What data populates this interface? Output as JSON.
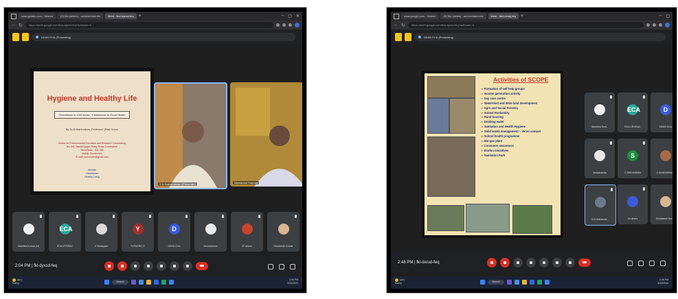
{
  "left": {
    "tabs": [
      "www.gstatic.com - Search",
      "(9) Bio (slides) - archivetuberrofs",
      "Meet - fkul-dyexd-feq"
    ],
    "url": "https://meet.google.com/fkul-dyexd-feq?authuser=0",
    "presenting": "DEAN ECA (Presenting)",
    "slide": {
      "title": "Hygiene and Healthy Life",
      "box": "Cleanliness to God liness : Cleanliness to Good Health",
      "by": "By  Dr.N.Mahendran, Professor (Rtd) Hosur",
      "red_lines": [
        "Centre for Environmental Education and Research Consultancy",
        "No. 6/6, Nanda Nagar, Sathy Road, Coimbatore",
        "Tamil Nadu - 641 006",
        "Mobile: 9xxxxxxxxx",
        "E-mail: xxxxxxxxx@gmail.com"
      ],
      "blue_lines": [
        "Website",
        "Cleanliness",
        "Healthy Living"
      ]
    },
    "videos": [
      {
        "name": "S.N.Subramanian (Presenter)"
      },
      {
        "name": "Sivaraman Kannan"
      }
    ],
    "tiles": [
      {
        "label": "Manthira Kumar (Lt)",
        "letter": "",
        "color": "#f0f0f0"
      },
      {
        "label": "ECA CRGRAC",
        "letter": "ECA",
        "color": "#2aa89a"
      },
      {
        "label": "S Mariappan",
        "letter": "",
        "color": "#d9d9d9"
      },
      {
        "label": "TVPAGRIS E",
        "letter": "Y",
        "color": "#a1302a"
      },
      {
        "label": "DEAN ECA",
        "letter": "D",
        "color": "#3b5bdb"
      },
      {
        "label": "Venkatraman",
        "letter": "",
        "color": "#e8e8e8"
      },
      {
        "label": "37 others",
        "letter": "",
        "color": "#c7452e"
      },
      {
        "label": "Sunderesh Kumar",
        "letter": "",
        "color": "#d6b694"
      }
    ],
    "time": "2:04 PM | fkl-dyxsd-feq",
    "taskbar": {
      "weather": "34°C",
      "weather_sub": "Sunny",
      "search": "Search",
      "clock": "2:04 PM",
      "date": "5/31/2024"
    }
  },
  "right": {
    "tabs": [
      "www.google.com - Search",
      "(9) Bio (slides) - archivetuberrofs",
      "Meet - fkul-dxhej-feq"
    ],
    "url": "https://meet.google.com/fkul-dyxsd-feq?authuser=0",
    "presenting": "DEAN ECA (Presenting)",
    "slide": {
      "title": "Activities of SCOPE",
      "items": [
        "Formation of self help groups",
        "Income generation activity",
        "Day care centre",
        "Watershed and Wste land development",
        "Agro and Social Forestry",
        "Animal Husbandry",
        "Rural housing",
        "Drinking water",
        "Sanitation and Health Hygiene",
        "Solid waste management – Vermi compot",
        "School health programme",
        "Bio-gas plant",
        "Consumer awareness",
        "Ecofun iniciatives",
        "Sanitation Park"
      ]
    },
    "tiles": [
      {
        "label": "Manthira Kum..",
        "letter": "",
        "color": "#f0f0f0"
      },
      {
        "label": "ECA CRGRAC",
        "letter": "ECA",
        "color": "#2aa89a"
      },
      {
        "label": "DEAN ECA",
        "letter": "D",
        "color": "#3b5bdb"
      },
      {
        "label": "Venkatraman",
        "letter": "",
        "color": "#e8e8e8"
      },
      {
        "label": "S.SRIDHARAN",
        "letter": "S",
        "color": "#1e8e3e"
      },
      {
        "label": "A SUNDARAM M",
        "letter": "",
        "color": "#a56b4a"
      },
      {
        "label": "S.N.Subraman...",
        "letter": "",
        "color": "#6b7b8b"
      },
      {
        "label": "16 others",
        "letter": "",
        "color": "#3b5bdb"
      },
      {
        "label": "Sundaresh Kumar",
        "letter": "",
        "color": "#d6b694"
      }
    ],
    "time": "2:46 PM | fkl-dxrud-feq",
    "taskbar": {
      "weather": "34°C",
      "weather_sub": "Sunny",
      "search": "Search",
      "clock": "2:46 PM",
      "date": "5/31/2024"
    }
  }
}
